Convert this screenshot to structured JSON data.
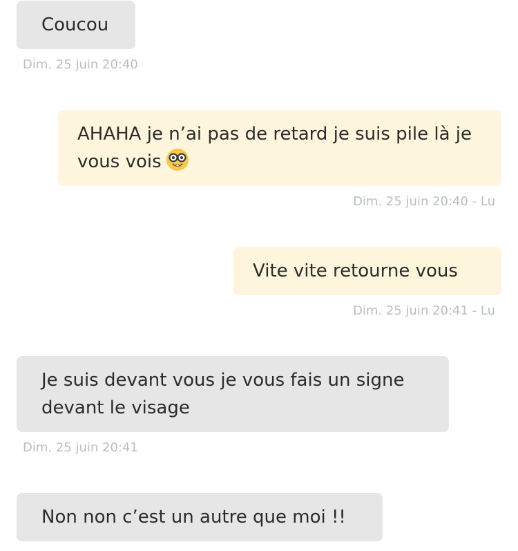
{
  "messages": [
    {
      "direction": "received",
      "text": "Coucou",
      "meta": "Dim. 25 juin 20:40"
    },
    {
      "direction": "sent",
      "text": "AHAHA je n’ai pas de retard je suis pile là je vous vois",
      "emoji": "nerd-face",
      "meta": "Dim. 25 juin 20:40 - Lu"
    },
    {
      "direction": "sent",
      "text": "Vite vite retourne vous",
      "meta": "Dim. 25 juin 20:41 - Lu"
    },
    {
      "direction": "received",
      "text": "Je suis devant vous je vous fais un signe devant le visage",
      "meta": "Dim. 25 juin 20:41"
    },
    {
      "direction": "received",
      "text": "Non non c’est un autre que moi !!",
      "meta": ""
    }
  ],
  "colors": {
    "received_bubble": "#e6e6e6",
    "sent_bubble": "#fdf6dc",
    "text": "#2b2b2b",
    "meta_text": "#b9bec4"
  }
}
